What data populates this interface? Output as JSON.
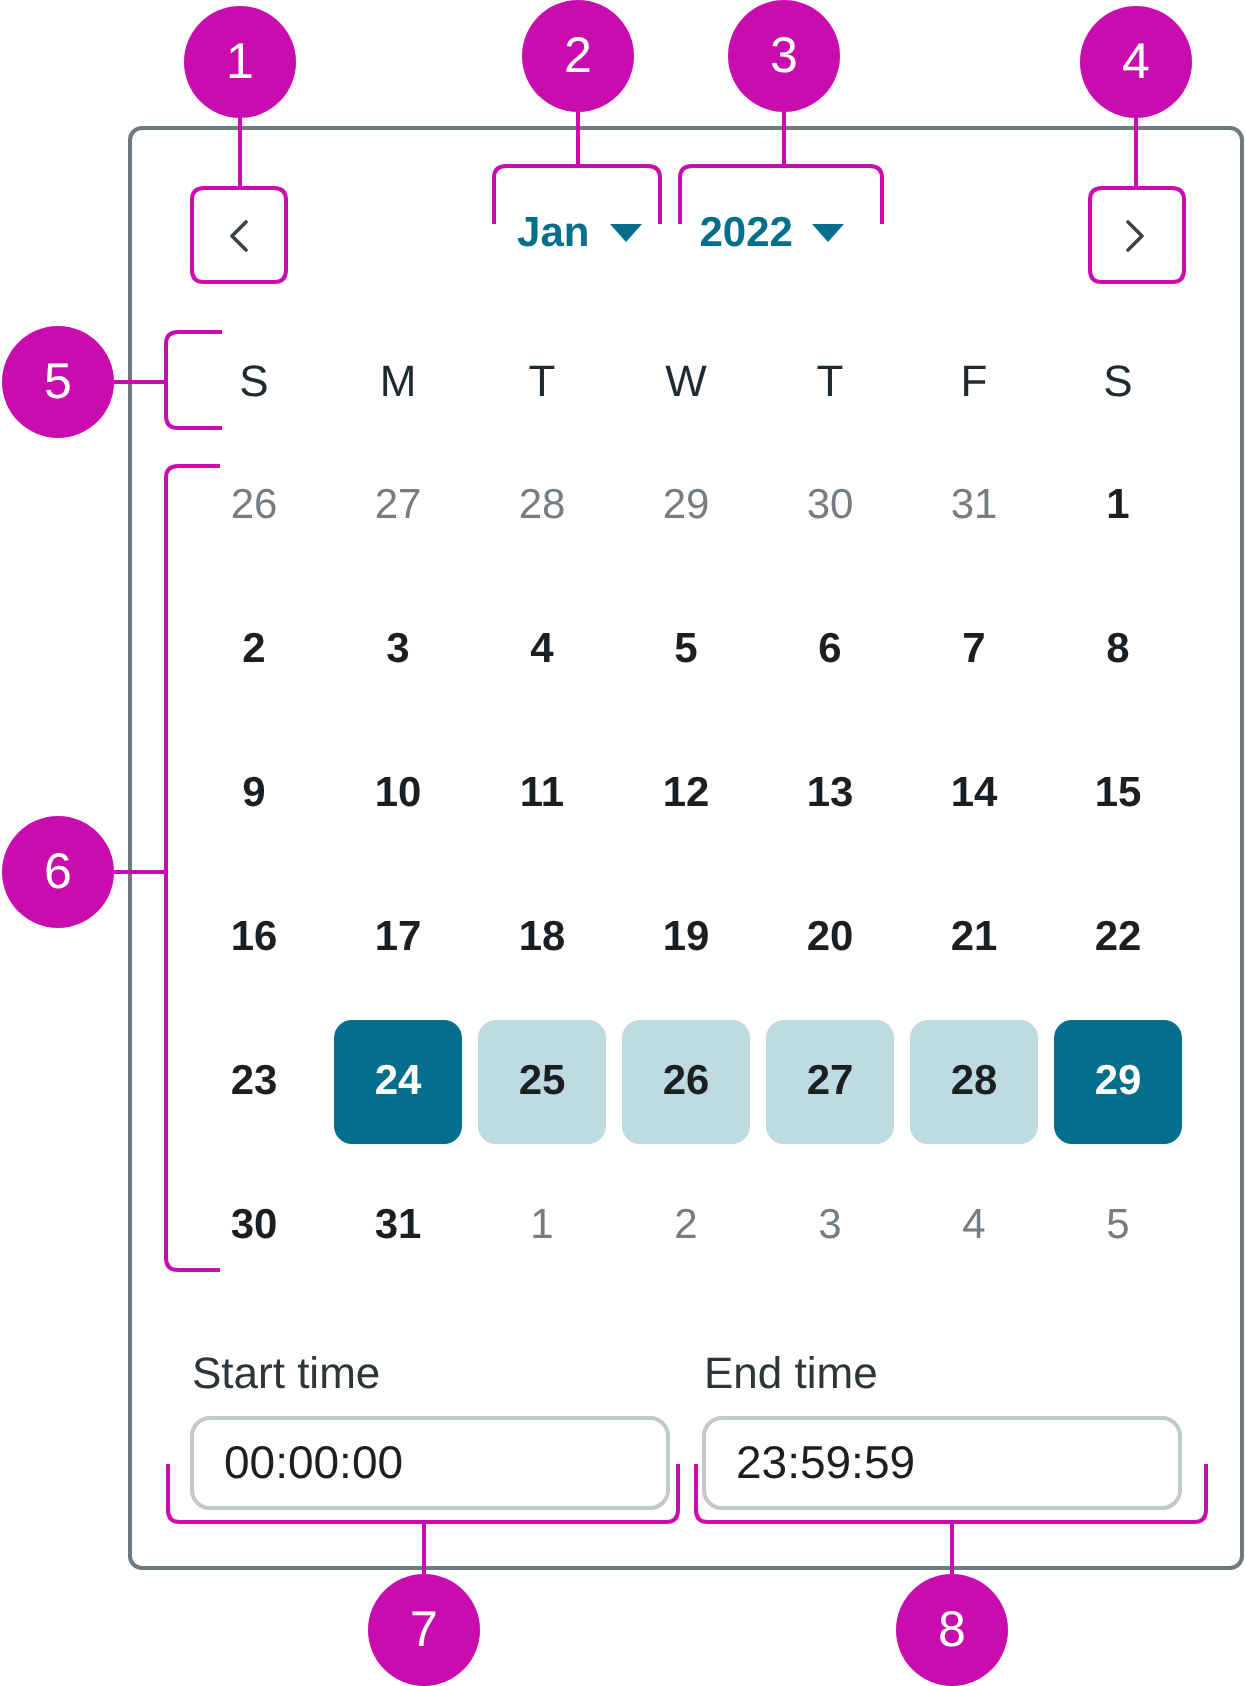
{
  "annotations": [
    {
      "number": "1"
    },
    {
      "number": "2"
    },
    {
      "number": "3"
    },
    {
      "number": "4"
    },
    {
      "number": "5"
    },
    {
      "number": "6"
    },
    {
      "number": "7"
    },
    {
      "number": "8"
    }
  ],
  "calendar": {
    "month": "Jan",
    "year": "2022",
    "weekdays": [
      "S",
      "M",
      "T",
      "W",
      "T",
      "F",
      "S"
    ],
    "weeks": [
      [
        {
          "day": "26",
          "outside_month": true,
          "selected": false,
          "in_range": false
        },
        {
          "day": "27",
          "outside_month": true,
          "selected": false,
          "in_range": false
        },
        {
          "day": "28",
          "outside_month": true,
          "selected": false,
          "in_range": false
        },
        {
          "day": "29",
          "outside_month": true,
          "selected": false,
          "in_range": false
        },
        {
          "day": "30",
          "outside_month": true,
          "selected": false,
          "in_range": false
        },
        {
          "day": "31",
          "outside_month": true,
          "selected": false,
          "in_range": false
        },
        {
          "day": "1",
          "outside_month": false,
          "selected": false,
          "in_range": false
        }
      ],
      [
        {
          "day": "2",
          "outside_month": false,
          "selected": false,
          "in_range": false
        },
        {
          "day": "3",
          "outside_month": false,
          "selected": false,
          "in_range": false
        },
        {
          "day": "4",
          "outside_month": false,
          "selected": false,
          "in_range": false
        },
        {
          "day": "5",
          "outside_month": false,
          "selected": false,
          "in_range": false
        },
        {
          "day": "6",
          "outside_month": false,
          "selected": false,
          "in_range": false
        },
        {
          "day": "7",
          "outside_month": false,
          "selected": false,
          "in_range": false
        },
        {
          "day": "8",
          "outside_month": false,
          "selected": false,
          "in_range": false
        }
      ],
      [
        {
          "day": "9",
          "outside_month": false,
          "selected": false,
          "in_range": false
        },
        {
          "day": "10",
          "outside_month": false,
          "selected": false,
          "in_range": false
        },
        {
          "day": "11",
          "outside_month": false,
          "selected": false,
          "in_range": false
        },
        {
          "day": "12",
          "outside_month": false,
          "selected": false,
          "in_range": false
        },
        {
          "day": "13",
          "outside_month": false,
          "selected": false,
          "in_range": false
        },
        {
          "day": "14",
          "outside_month": false,
          "selected": false,
          "in_range": false
        },
        {
          "day": "15",
          "outside_month": false,
          "selected": false,
          "in_range": false
        }
      ],
      [
        {
          "day": "16",
          "outside_month": false,
          "selected": false,
          "in_range": false
        },
        {
          "day": "17",
          "outside_month": false,
          "selected": false,
          "in_range": false
        },
        {
          "day": "18",
          "outside_month": false,
          "selected": false,
          "in_range": false
        },
        {
          "day": "19",
          "outside_month": false,
          "selected": false,
          "in_range": false
        },
        {
          "day": "20",
          "outside_month": false,
          "selected": false,
          "in_range": false
        },
        {
          "day": "21",
          "outside_month": false,
          "selected": false,
          "in_range": false
        },
        {
          "day": "22",
          "outside_month": false,
          "selected": false,
          "in_range": false
        }
      ],
      [
        {
          "day": "23",
          "outside_month": false,
          "selected": false,
          "in_range": false
        },
        {
          "day": "24",
          "outside_month": false,
          "selected": true,
          "in_range": false
        },
        {
          "day": "25",
          "outside_month": false,
          "selected": false,
          "in_range": true
        },
        {
          "day": "26",
          "outside_month": false,
          "selected": false,
          "in_range": true
        },
        {
          "day": "27",
          "outside_month": false,
          "selected": false,
          "in_range": true
        },
        {
          "day": "28",
          "outside_month": false,
          "selected": false,
          "in_range": true
        },
        {
          "day": "29",
          "outside_month": false,
          "selected": true,
          "in_range": false
        }
      ],
      [
        {
          "day": "30",
          "outside_month": false,
          "selected": false,
          "in_range": false
        },
        {
          "day": "31",
          "outside_month": false,
          "selected": false,
          "in_range": false
        },
        {
          "day": "1",
          "outside_month": true,
          "selected": false,
          "in_range": false
        },
        {
          "day": "2",
          "outside_month": true,
          "selected": false,
          "in_range": false
        },
        {
          "day": "3",
          "outside_month": true,
          "selected": false,
          "in_range": false
        },
        {
          "day": "4",
          "outside_month": true,
          "selected": false,
          "in_range": false
        },
        {
          "day": "5",
          "outside_month": true,
          "selected": false,
          "in_range": false
        }
      ]
    ]
  },
  "start_time": {
    "label": "Start time",
    "value": "00:00:00"
  },
  "end_time": {
    "label": "End time",
    "value": "23:59:59"
  }
}
